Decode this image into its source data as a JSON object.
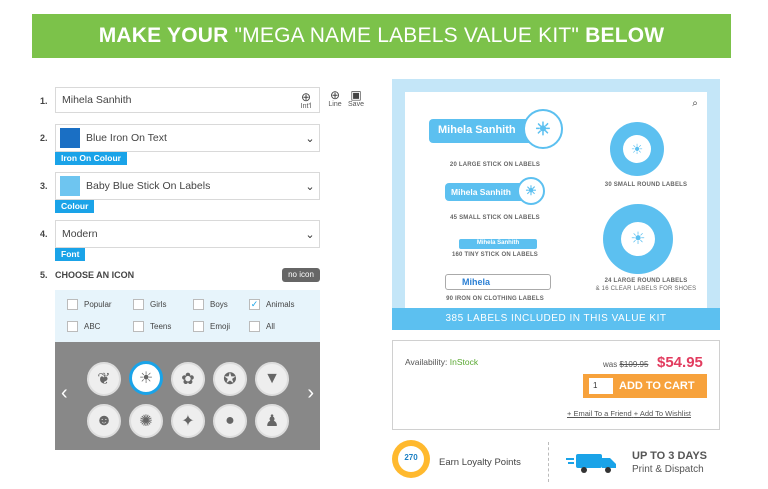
{
  "banner": {
    "part1": "MAKE YOUR",
    "part2": " \"MEGA NAME LABELS VALUE KIT\" ",
    "part3": "BELOW"
  },
  "steps": {
    "s1": {
      "num": "1.",
      "value": "Mihela Sanhith",
      "intl": "Int'l",
      "line": "Line",
      "save": "Save"
    },
    "s2": {
      "num": "2.",
      "value": "Blue Iron On Text",
      "tag": "Iron On Colour",
      "swatch": "#1a6fc4"
    },
    "s3": {
      "num": "3.",
      "value": "Baby Blue Stick On Labels",
      "tag": "Colour",
      "swatch": "#6ec5f0"
    },
    "s4": {
      "num": "4.",
      "value": "Modern",
      "tag": "Font"
    },
    "s5": {
      "num": "5.",
      "label": "CHOOSE AN ICON",
      "noicon": "no icon"
    }
  },
  "categories": [
    {
      "label": "Popular",
      "checked": false
    },
    {
      "label": "Girls",
      "checked": false
    },
    {
      "label": "Boys",
      "checked": false
    },
    {
      "label": "Animals",
      "checked": true
    },
    {
      "label": "ABC",
      "checked": false
    },
    {
      "label": "Teens",
      "checked": false
    },
    {
      "label": "Emoji",
      "checked": false
    },
    {
      "label": "All",
      "checked": false
    }
  ],
  "icons": [
    "leaf-icon",
    "lion-icon",
    "bird-icon",
    "ladybug-icon",
    "fox-icon",
    "cat-icon",
    "monkey-icon",
    "eagle-icon",
    "panda-icon",
    "penguin-icon"
  ],
  "preview": {
    "name": "Mihela Sanhith",
    "name_short": "Mihela",
    "caption1": "20 LARGE STICK ON LABELS",
    "caption2": "45 SMALL STICK ON LABELS",
    "caption3": "160 TINY STICK ON LABELS",
    "caption4": "90 IRON ON CLOTHING LABELS",
    "caption5": "30 SMALL ROUND LABELS",
    "caption6a": "24 LARGE ROUND LABELS",
    "caption6b": "& 16 CLEAR LABELS FOR SHOES",
    "footer": "385 LABELS INCLUDED IN THIS VALUE KIT",
    "accent": "#5cc0f0"
  },
  "buy": {
    "availability_label": "Availability:",
    "availability_value": "InStock",
    "was_label": "was",
    "was_price": "$109.95",
    "price": "$54.95",
    "qty": "1",
    "add_to_cart": "ADD TO CART",
    "email_link": "+ Email To a Friend",
    "wishlist_link": "+ Add To Wishlist"
  },
  "loyalty": {
    "points": "270",
    "text": "Earn Loyalty Points"
  },
  "dispatch": {
    "line1": "UP TO 3 DAYS",
    "line2": "Print & Dispatch"
  },
  "colors": {
    "banner": "#7cc24a",
    "accent": "#1aa3e8",
    "cart": "#f7a23c",
    "price": "#e23c5f"
  }
}
